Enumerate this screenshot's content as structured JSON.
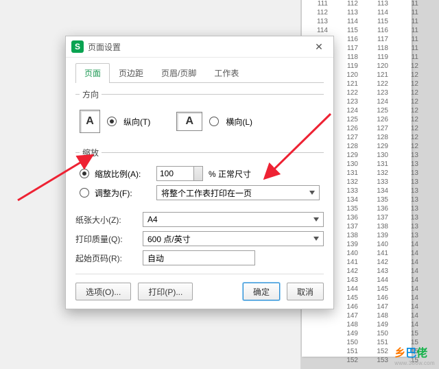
{
  "dialog": {
    "title": "页面设置",
    "tabs": [
      "页面",
      "页边距",
      "页眉/页脚",
      "工作表"
    ],
    "orientation": {
      "legend": "方向",
      "portrait": "纵向(T)",
      "landscape": "横向(L)"
    },
    "scaling": {
      "legend": "缩放",
      "ratio_label": "缩放比例(A):",
      "ratio_value": "100",
      "ratio_suffix": "% 正常尺寸",
      "fit_label": "调整为(F):",
      "fit_value": "将整个工作表打印在一页"
    },
    "paper": {
      "size_label": "纸张大小(Z):",
      "size_value": "A4",
      "quality_label": "打印质量(Q):",
      "quality_value": "600 点/英寸",
      "startpage_label": "起始页码(R):",
      "startpage_value": "自动"
    },
    "buttons": {
      "options": "选项(O)...",
      "print": "打印(P)...",
      "ok": "确定",
      "cancel": "取消"
    }
  },
  "sheet_columns": {
    "c0": [
      "111",
      "112",
      "113",
      "114",
      "",
      "",
      "",
      "",
      "",
      "",
      "",
      "",
      "",
      "",
      "",
      "",
      "",
      "",
      "",
      "",
      "",
      "",
      "",
      "",
      "",
      "",
      "",
      "",
      "",
      "",
      "",
      "",
      "",
      "",
      "",
      "",
      "",
      "",
      "",
      "",
      "",
      ""
    ],
    "c1": [
      "112",
      "113",
      "114",
      "115",
      "116",
      "117",
      "118",
      "119",
      "120",
      "121",
      "122",
      "123",
      "124",
      "125",
      "126",
      "127",
      "128",
      "129",
      "130",
      "131",
      "132",
      "133",
      "134",
      "135",
      "136",
      "137",
      "138",
      "139",
      "140",
      "141",
      "142",
      "143",
      "144",
      "145",
      "146",
      "147",
      "148",
      "149",
      "150",
      "151",
      "152"
    ],
    "c2": [
      "113",
      "114",
      "115",
      "116",
      "117",
      "118",
      "119",
      "120",
      "121",
      "122",
      "123",
      "124",
      "125",
      "126",
      "127",
      "128",
      "129",
      "130",
      "131",
      "132",
      "133",
      "134",
      "135",
      "136",
      "137",
      "138",
      "139",
      "140",
      "141",
      "142",
      "143",
      "144",
      "145",
      "146",
      "147",
      "148",
      "149",
      "150",
      "151",
      "152",
      "153"
    ],
    "c3": [
      "11",
      "11",
      "11",
      "11",
      "11",
      "11",
      "11",
      "12",
      "12",
      "12",
      "12",
      "12",
      "12",
      "12",
      "12",
      "12",
      "12",
      "13",
      "13",
      "13",
      "13",
      "13",
      "13",
      "13",
      "13",
      "13",
      "13",
      "14",
      "14",
      "14",
      "14",
      "14",
      "14",
      "14",
      "14",
      "14",
      "14",
      "15",
      "15",
      "15",
      "15"
    ]
  },
  "watermark": {
    "text": "乡巴佬",
    "url": "www.386w.com"
  }
}
